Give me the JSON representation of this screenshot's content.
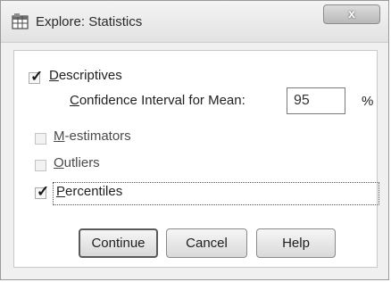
{
  "window": {
    "title": "Explore: Statistics",
    "close_label": "x"
  },
  "options": {
    "descriptives": {
      "prefix": "",
      "accel": "D",
      "rest": "escriptives",
      "checked": true
    },
    "confidence": {
      "accel": "C",
      "rest": "onfidence Interval for Mean:",
      "value": "95",
      "unit": "%"
    },
    "m_estimators": {
      "prefix": "",
      "accel": "M",
      "rest": "-estimators",
      "checked": false
    },
    "outliers": {
      "prefix": "",
      "accel": "O",
      "rest": "utliers",
      "checked": false
    },
    "percentiles": {
      "prefix": "",
      "accel": "P",
      "rest": "ercentiles",
      "checked": true
    }
  },
  "buttons": {
    "continue": "Continue",
    "cancel": "Cancel",
    "help": "Help"
  },
  "icons": {
    "app": "spss-table-icon",
    "check": "checkmark-icon"
  }
}
